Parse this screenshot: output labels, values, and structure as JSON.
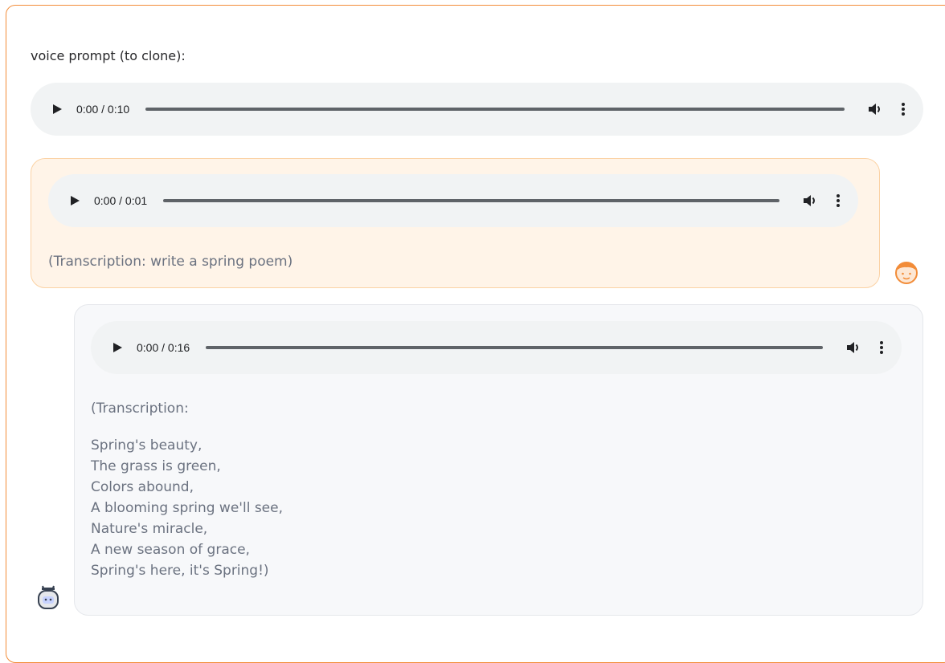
{
  "prompt": {
    "label": "voice prompt (to clone):"
  },
  "players": {
    "prompt": {
      "time": "0:00 / 0:10"
    },
    "user": {
      "time": "0:00 / 0:01"
    },
    "bot": {
      "time": "0:00 / 0:16"
    }
  },
  "user_message": {
    "transcription": "(Transcription: write a spring poem)"
  },
  "bot_message": {
    "transcription_head": "(Transcription:",
    "poem": [
      "Spring's beauty,",
      "The grass is green,",
      "Colors abound,",
      "A blooming spring we'll see,",
      "Nature's miracle,",
      "A new season of grace,",
      "Spring's here, it's Spring!)"
    ]
  },
  "colors": {
    "accent": "#f28c38",
    "user_bubble": "#fff4e8",
    "bot_bubble": "#f7f8fa",
    "player": "#f1f3f4"
  },
  "icons": [
    "play-icon",
    "volume-icon",
    "more-vert-icon",
    "user-avatar-icon",
    "bot-avatar-icon"
  ]
}
